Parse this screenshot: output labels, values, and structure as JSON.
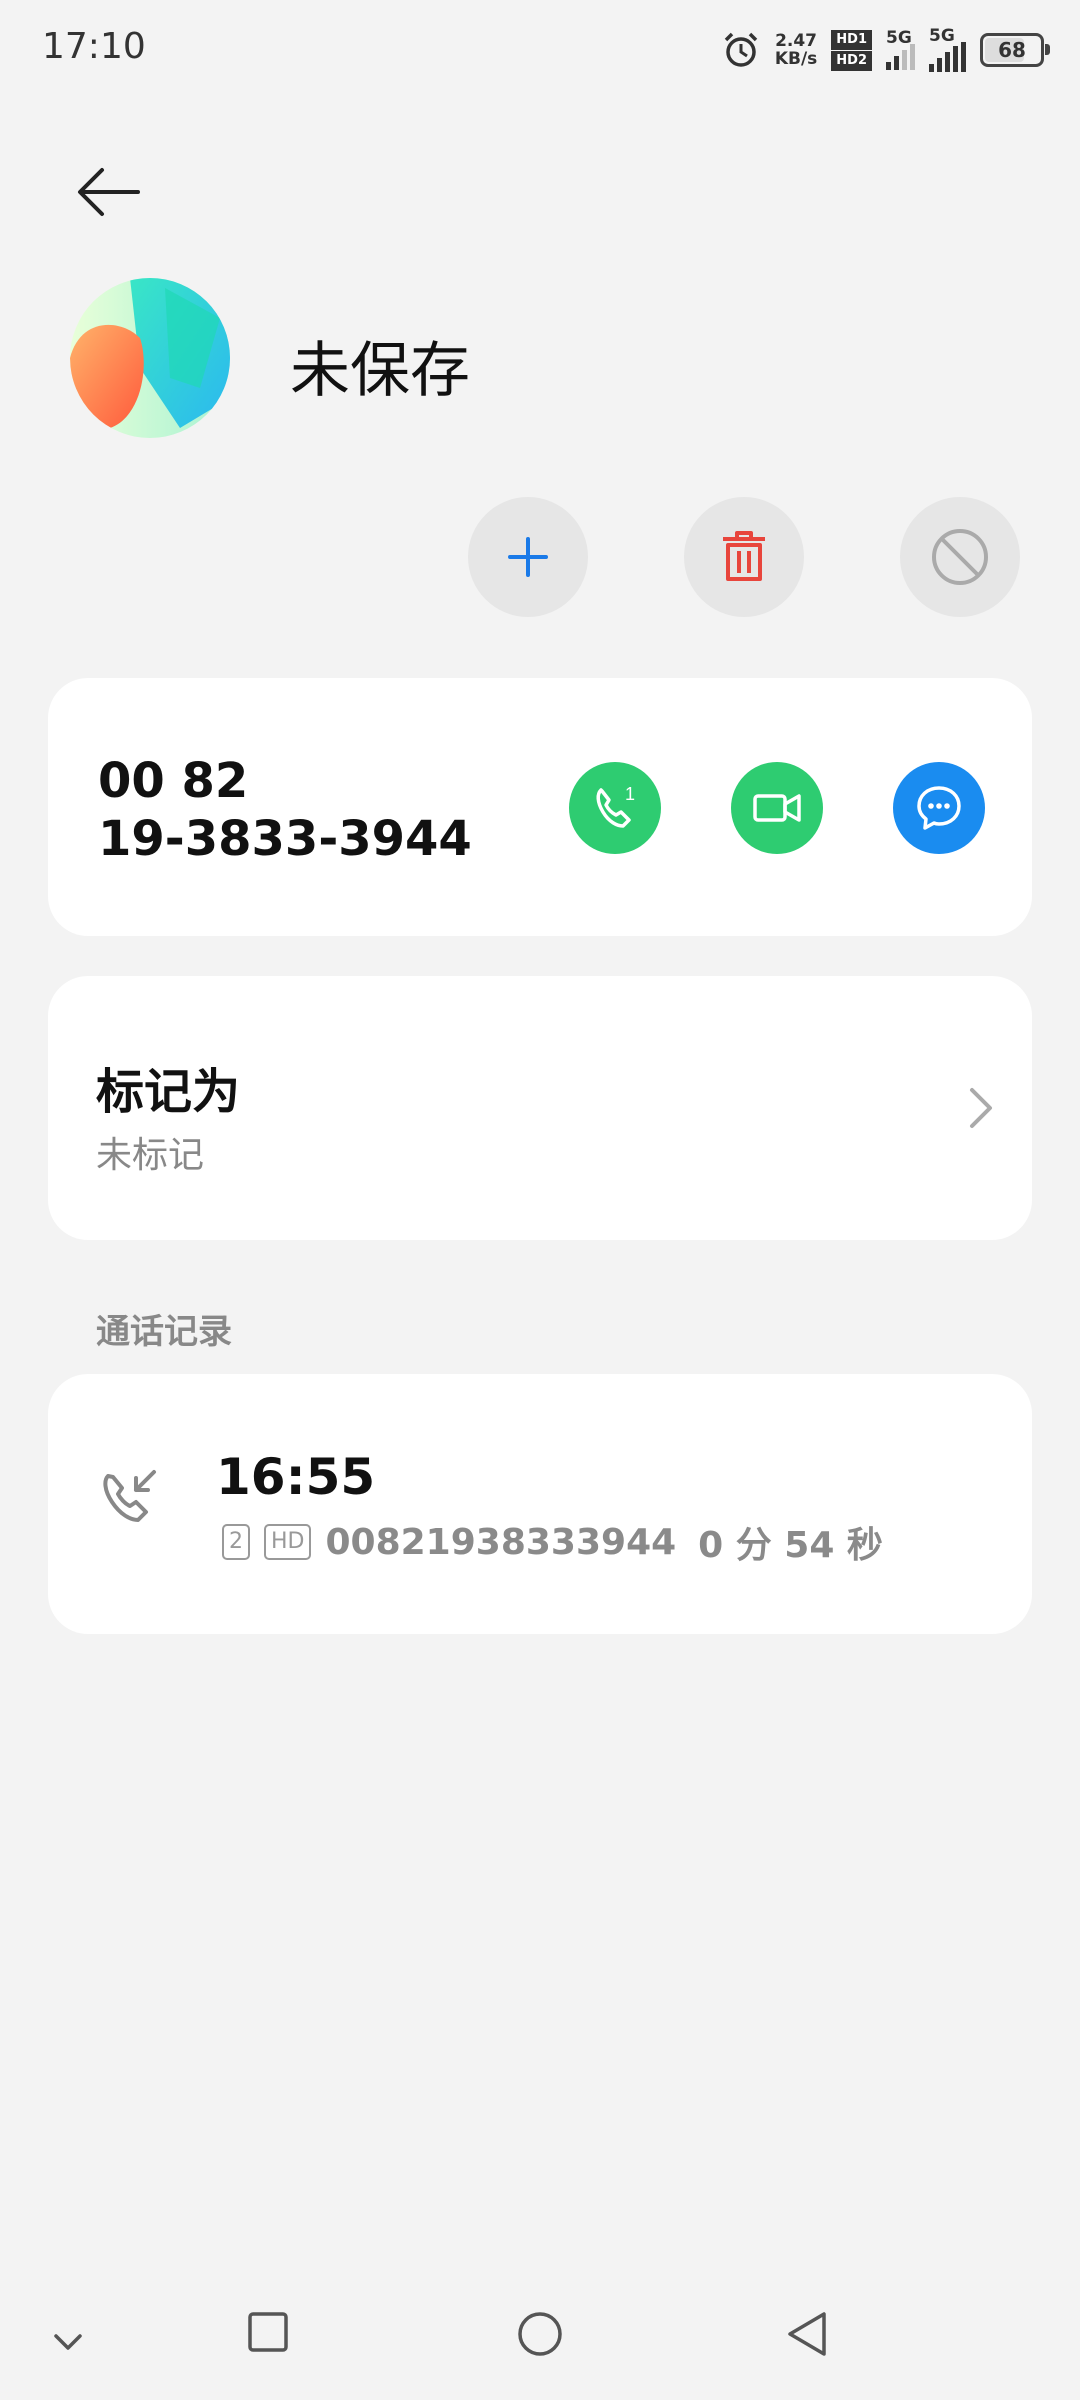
{
  "status_bar": {
    "time": "17:10",
    "speed_value": "2.47",
    "speed_unit": "KB/s",
    "hd1": "HD1",
    "hd2": "HD2",
    "sim1_network": "5G",
    "sim2_network": "5G",
    "battery": "68",
    "icons": [
      "alarm-icon",
      "hd-icon",
      "signal-icon",
      "battery-icon"
    ]
  },
  "header": {
    "back_icon": "back-arrow-icon"
  },
  "contact": {
    "name": "未保存",
    "avatar_icon": "default-avatar"
  },
  "actions": {
    "add_icon": "plus-icon",
    "delete_icon": "trash-icon",
    "block_icon": "block-icon"
  },
  "number_card": {
    "line1": "00 82",
    "line2": "19-3833-3944",
    "call_icon": "phone-sim1-icon",
    "video_icon": "video-call-icon",
    "message_icon": "message-icon",
    "colors": {
      "call": "#2ecc71",
      "video": "#2ecc71",
      "message": "#1a8cf0"
    }
  },
  "mark_card": {
    "title": "标记为",
    "subtitle": "未标记"
  },
  "call_log": {
    "section_title": "通话记录",
    "entries": [
      {
        "time": "16:55",
        "sim": "2",
        "hd": "HD",
        "number": "00821938333944",
        "duration": "0 分 54 秒"
      }
    ]
  },
  "nav_bar": {
    "icons": [
      "collapse-chevron-icon",
      "recents-square-icon",
      "home-circle-icon",
      "back-triangle-icon"
    ]
  }
}
